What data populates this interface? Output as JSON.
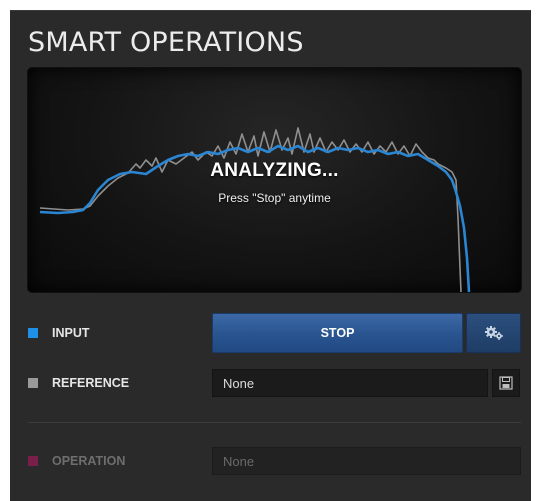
{
  "panel": {
    "title": "SMART OPERATIONS"
  },
  "display": {
    "status": "ANALYZING...",
    "hint": "Press \"Stop\" anytime"
  },
  "input": {
    "label": "INPUT",
    "color": "#1e90e6",
    "stop_label": "STOP",
    "settings_icon": "gears-icon"
  },
  "reference": {
    "label": "REFERENCE",
    "color": "#9a9a9a",
    "value": "None",
    "save_icon": "save-icon"
  },
  "operation": {
    "label": "OPERATION",
    "color": "#7a1f4a",
    "value": "None",
    "disabled": true
  },
  "colors": {
    "panel_bg": "#2a2a2a",
    "accent_blue": "#2a5591",
    "curve_input": "#2a86d2",
    "curve_reference": "#8a8a8a"
  }
}
